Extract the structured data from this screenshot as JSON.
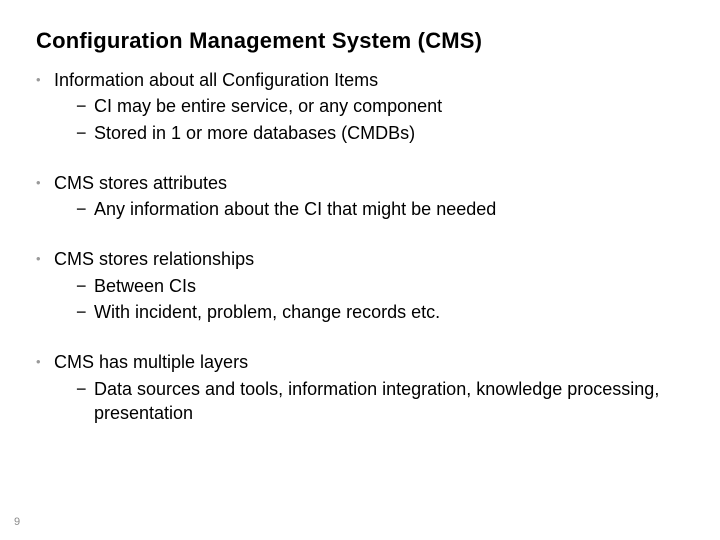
{
  "title": "Configuration Management System (CMS)",
  "bullets": [
    {
      "text": "Information about all Configuration Items",
      "sub": [
        "CI may be entire service, or any component",
        "Stored in 1 or more databases (CMDBs)"
      ]
    },
    {
      "text": "CMS stores attributes",
      "sub": [
        "Any information about the CI that might be needed"
      ]
    },
    {
      "text": "CMS stores relationships",
      "sub": [
        "Between CIs",
        "With incident, problem, change records etc."
      ]
    },
    {
      "text": "CMS has multiple layers",
      "sub": [
        "Data sources and tools, information integration, knowledge processing, presentation"
      ]
    }
  ],
  "page_number": "9"
}
